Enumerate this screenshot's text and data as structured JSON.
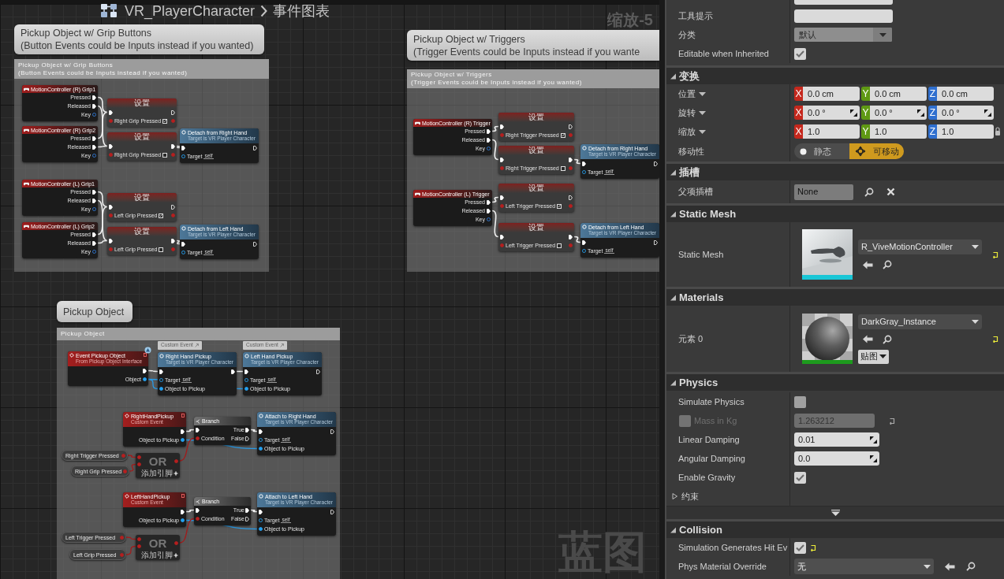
{
  "graph": {
    "breadcrumb": {
      "blueprint": "VR_PlayerCharacter",
      "graph": "事件图表"
    },
    "zoom": "缩放-5",
    "watermark": "蓝图",
    "comments": [
      {
        "bubble": [
          "Pickup Object w/ Grip Buttons",
          "(Button Events could be Inputs instead if you wanted)"
        ],
        "header": [
          "Pickup Object w/ Grip Buttons",
          "(Button Events could be Inputs instead if you wanted)"
        ],
        "nodes": [
          {
            "kind": "input",
            "title": "MotionController (R) Grip1",
            "pins": [
              {
                "label": "Pressed",
                "kind": "exec"
              },
              {
                "label": "Released",
                "kind": "exec"
              },
              {
                "label": "Key",
                "kind": "key"
              }
            ]
          },
          {
            "kind": "set",
            "title": "设置",
            "variable": "Right Grip Pressed",
            "checked": true
          },
          {
            "kind": "input",
            "title": "MotionController (R) Grip2",
            "pins": [
              {
                "label": "Pressed",
                "kind": "exec"
              },
              {
                "label": "Released",
                "kind": "exec"
              },
              {
                "label": "Key",
                "kind": "key"
              }
            ]
          },
          {
            "kind": "set",
            "title": "设置",
            "variable": "Right Grip Pressed",
            "checked": false
          },
          {
            "kind": "function",
            "title": "Detach from Right Hand",
            "subtitle": "Target is VR Player Character",
            "pins": [
              {
                "label": "Target",
                "kind": "object",
                "value": "self"
              }
            ]
          },
          {
            "kind": "input",
            "title": "MotionController (L) Grip1",
            "pins": [
              {
                "label": "Pressed",
                "kind": "exec"
              },
              {
                "label": "Released",
                "kind": "exec"
              },
              {
                "label": "Key",
                "kind": "key"
              }
            ]
          },
          {
            "kind": "set",
            "title": "设置",
            "variable": "Left Grip Pressed",
            "checked": true
          },
          {
            "kind": "input",
            "title": "MotionController (L) Grip2",
            "pins": [
              {
                "label": "Pressed",
                "kind": "exec"
              },
              {
                "label": "Released",
                "kind": "exec"
              },
              {
                "label": "Key",
                "kind": "key"
              }
            ]
          },
          {
            "kind": "set",
            "title": "设置",
            "variable": "Left Grip Pressed",
            "checked": false
          },
          {
            "kind": "function",
            "title": "Detach from Left Hand",
            "subtitle": "Target is VR Player Character",
            "pins": [
              {
                "label": "Target",
                "kind": "object",
                "value": "self"
              }
            ]
          }
        ]
      },
      {
        "bubble": [
          "Pickup Object w/ Triggers",
          "(Trigger Events could be Inputs instead if you wante"
        ],
        "header": [
          "Pickup Object w/ Triggers",
          "(Trigger Events could be Inputs instead if you wanted)"
        ],
        "nodes": [
          {
            "kind": "input",
            "title": "MotionController (R) Trigger",
            "pins": [
              {
                "label": "Pressed",
                "kind": "exec"
              },
              {
                "label": "Released",
                "kind": "exec"
              },
              {
                "label": "Key",
                "kind": "key"
              }
            ]
          },
          {
            "kind": "set",
            "title": "设置",
            "variable": "Right Trigger Pressed",
            "checked": true
          },
          {
            "kind": "set",
            "title": "设置",
            "variable": "Right Trigger Pressed",
            "checked": false
          },
          {
            "kind": "function",
            "title": "Detach from Right Hand",
            "subtitle": "Target is VR Player Character",
            "pins": [
              {
                "label": "Target",
                "kind": "object",
                "value": "self"
              }
            ]
          },
          {
            "kind": "input",
            "title": "MotionController (L) Trigger",
            "pins": [
              {
                "label": "Pressed",
                "kind": "exec"
              },
              {
                "label": "Released",
                "kind": "exec"
              },
              {
                "label": "Key",
                "kind": "key"
              }
            ]
          },
          {
            "kind": "set",
            "title": "设置",
            "variable": "Left Trigger Pressed",
            "checked": true
          },
          {
            "kind": "set",
            "title": "设置",
            "variable": "Left Trigger Pressed",
            "checked": false
          },
          {
            "kind": "function",
            "title": "Detach from Left Hand",
            "subtitle": "Target is VR Player Character",
            "pins": [
              {
                "label": "Target",
                "kind": "object",
                "value": "self"
              }
            ]
          }
        ]
      },
      {
        "bubble": [
          "Pickup Object"
        ],
        "header": [
          "Pickup Object"
        ],
        "nodes": [
          {
            "kind": "event",
            "title": "Event Pickup Object",
            "subtitle": "From Pickup Object Interface",
            "interface": true,
            "outputs": [
              {
                "label": "Object",
                "kind": "object"
              }
            ]
          },
          {
            "kind": "tag",
            "label": "Custom Event"
          },
          {
            "kind": "function",
            "title": "Right Hand Pickup",
            "subtitle": "Target is VR Player Character",
            "pins": [
              {
                "label": "Target",
                "kind": "object",
                "value": "self"
              },
              {
                "label": "Object to Pickup",
                "kind": "object"
              }
            ]
          },
          {
            "kind": "tag",
            "label": "Custom Event"
          },
          {
            "kind": "function",
            "title": "Left Hand Pickup",
            "subtitle": "Target is VR Player Character",
            "pins": [
              {
                "label": "Target",
                "kind": "object",
                "value": "self"
              },
              {
                "label": "Object to Pickup",
                "kind": "object"
              }
            ]
          },
          {
            "kind": "event",
            "title": "RightHandPickup",
            "subtitle": "Custom Event",
            "interface": false,
            "outputs": [
              {
                "label": "Object to Pickup",
                "kind": "object"
              }
            ]
          },
          {
            "kind": "branch",
            "title": "Branch",
            "inputs": [
              {
                "label": "Condition",
                "kind": "bool"
              }
            ],
            "outputs": [
              {
                "label": "True",
                "kind": "exec"
              },
              {
                "label": "False",
                "kind": "exec"
              }
            ]
          },
          {
            "kind": "function",
            "title": "Attach to Right Hand",
            "subtitle": "Target is VR Player Character",
            "pins": [
              {
                "label": "Target",
                "kind": "object",
                "value": "self"
              },
              {
                "label": "Object to Pickup",
                "kind": "object"
              }
            ]
          },
          {
            "kind": "variable",
            "label": "Right Trigger Pressed"
          },
          {
            "kind": "variable",
            "label": "Right Grip Pressed"
          },
          {
            "kind": "or",
            "title": "OR",
            "add_pin": "添加引脚"
          },
          {
            "kind": "event",
            "title": "LeftHandPickup",
            "subtitle": "Custom Event",
            "interface": false,
            "outputs": [
              {
                "label": "Object to Pickup",
                "kind": "object"
              }
            ]
          },
          {
            "kind": "branch",
            "title": "Branch",
            "inputs": [
              {
                "label": "Condition",
                "kind": "bool"
              }
            ],
            "outputs": [
              {
                "label": "True",
                "kind": "exec"
              },
              {
                "label": "False",
                "kind": "exec"
              }
            ]
          },
          {
            "kind": "function",
            "title": "Attach to Left Hand",
            "subtitle": "Target is VR Player Character",
            "pins": [
              {
                "label": "Target",
                "kind": "object",
                "value": "self"
              },
              {
                "label": "Object to Pickup",
                "kind": "object"
              }
            ]
          },
          {
            "kind": "variable",
            "label": "Left Trigger Pressed"
          },
          {
            "kind": "variable",
            "label": "Left Grip Pressed"
          },
          {
            "kind": "or",
            "title": "OR",
            "add_pin": "添加引脚"
          }
        ]
      }
    ]
  },
  "details": {
    "top_rows": [
      {
        "kind": "text",
        "label": "工具提示"
      },
      {
        "kind": "dropdown",
        "label": "分类",
        "value": "默认"
      },
      {
        "kind": "checkbox",
        "label": "Editable when Inherited",
        "checked": true
      }
    ],
    "sections": [
      {
        "title": "变换",
        "expanded": true,
        "rows": [
          {
            "kind": "vector",
            "label": "位置",
            "spin": false,
            "lock": false,
            "fields": [
              {
                "axis": "X",
                "value": "0.0 cm"
              },
              {
                "axis": "Y",
                "value": "0.0 cm"
              },
              {
                "axis": "Z",
                "value": "0.0 cm"
              }
            ]
          },
          {
            "kind": "vector",
            "label": "旋转",
            "spin": true,
            "lock": false,
            "fields": [
              {
                "axis": "X",
                "value": "0.0 °"
              },
              {
                "axis": "Y",
                "value": "0.0 °"
              },
              {
                "axis": "Z",
                "value": "0.0 °"
              }
            ]
          },
          {
            "kind": "vector",
            "label": "缩放",
            "spin": false,
            "lock": true,
            "fields": [
              {
                "axis": "X",
                "value": "1.0"
              },
              {
                "axis": "Y",
                "value": "1.0"
              },
              {
                "axis": "Z",
                "value": "1.0"
              }
            ]
          },
          {
            "kind": "toggle",
            "label": "移动性",
            "options": [
              {
                "label": "静态",
                "selected": false
              },
              {
                "label": "可移动",
                "selected": true
              }
            ]
          }
        ]
      },
      {
        "title": "插槽",
        "expanded": true,
        "rows": [
          {
            "kind": "socket",
            "label": "父项插槽",
            "value": "None"
          }
        ]
      },
      {
        "title": "Static Mesh",
        "expanded": true,
        "rows": [
          {
            "kind": "mesh_asset",
            "label": "Static Mesh",
            "value": "R_ViveMotionController",
            "reset": true
          }
        ]
      },
      {
        "title": "Materials",
        "expanded": true,
        "rows": [
          {
            "kind": "material_asset",
            "label": "元素 0",
            "value": "DarkGray_Instance",
            "button": "贴图",
            "reset": true
          }
        ]
      },
      {
        "title": "Physics",
        "expanded": true,
        "advanced": true,
        "rows": [
          {
            "kind": "checkbox",
            "label": "Simulate Physics",
            "checked": false
          },
          {
            "kind": "number",
            "label": "Mass in Kg",
            "value": "1.263212",
            "override": true,
            "checked": false,
            "disabled": true,
            "reset": true
          },
          {
            "kind": "number",
            "label": "Linear Damping",
            "value": "0.01",
            "override": false,
            "disabled": false
          },
          {
            "kind": "number",
            "label": "Angular Damping",
            "value": "0.0",
            "override": false,
            "disabled": false
          },
          {
            "kind": "checkbox",
            "label": "Enable Gravity",
            "checked": true
          },
          {
            "kind": "group",
            "label": "约束",
            "expanded": false
          }
        ]
      },
      {
        "title": "Collision",
        "expanded": true,
        "rows": [
          {
            "kind": "checkbox",
            "label": "Simulation Generates Hit Ev",
            "checked": true,
            "reset": true
          },
          {
            "kind": "asset_dropdown",
            "label": "Phys Material Override",
            "value": "无"
          }
        ]
      }
    ]
  }
}
